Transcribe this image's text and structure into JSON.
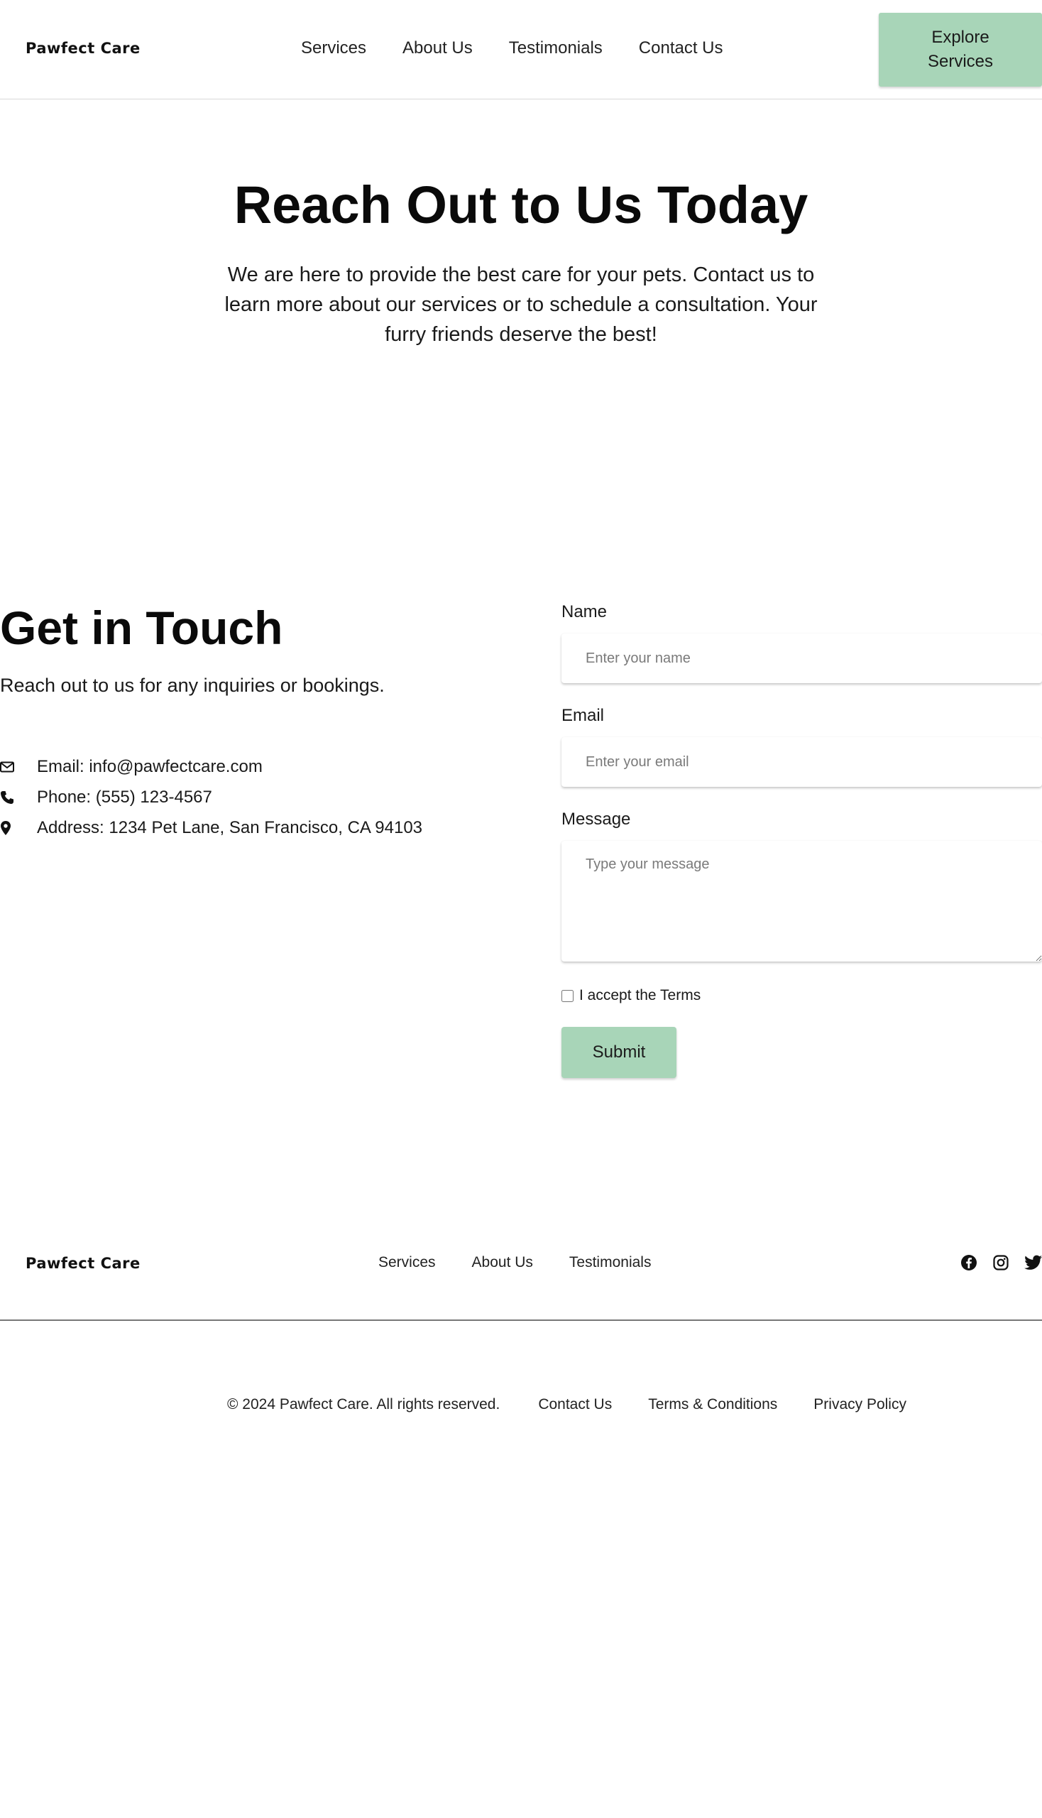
{
  "header": {
    "brand": "Pawfect Care",
    "nav": [
      "Services",
      "About Us",
      "Testimonials",
      "Contact Us"
    ],
    "cta_label": "Explore Services"
  },
  "hero": {
    "title": "Reach Out to Us Today",
    "text": "We are here to provide the best care for your pets. Contact us to learn more about our services or to schedule a consultation. Your furry friends deserve the best!"
  },
  "contact": {
    "title": "Get in Touch",
    "subtitle": "Reach out to us for any inquiries or bookings.",
    "info": [
      {
        "icon": "envelope-icon",
        "text": "Email: info@pawfectcare.com"
      },
      {
        "icon": "phone-icon",
        "text": "Phone: (555) 123-4567"
      },
      {
        "icon": "map-pin-icon",
        "text": "Address: 1234 Pet Lane, San Francisco, CA 94103"
      }
    ]
  },
  "form": {
    "name_label": "Name",
    "name_placeholder": "Enter your name",
    "email_label": "Email",
    "email_placeholder": "Enter your email",
    "message_label": "Message",
    "message_placeholder": "Type your message",
    "terms_label": "I accept the Terms",
    "submit_label": "Submit"
  },
  "footer": {
    "brand": "Pawfect Care",
    "nav": [
      "Services",
      "About Us",
      "Testimonials"
    ],
    "social": [
      "facebook-icon",
      "instagram-icon",
      "twitter-icon"
    ],
    "copyright": "© 2024 Pawfect Care. All rights reserved.",
    "links": [
      "Contact Us",
      "Terms & Conditions",
      "Privacy Policy"
    ]
  },
  "colors": {
    "accent": "#a8d5b8",
    "text": "#111111",
    "divider": "#777777"
  }
}
